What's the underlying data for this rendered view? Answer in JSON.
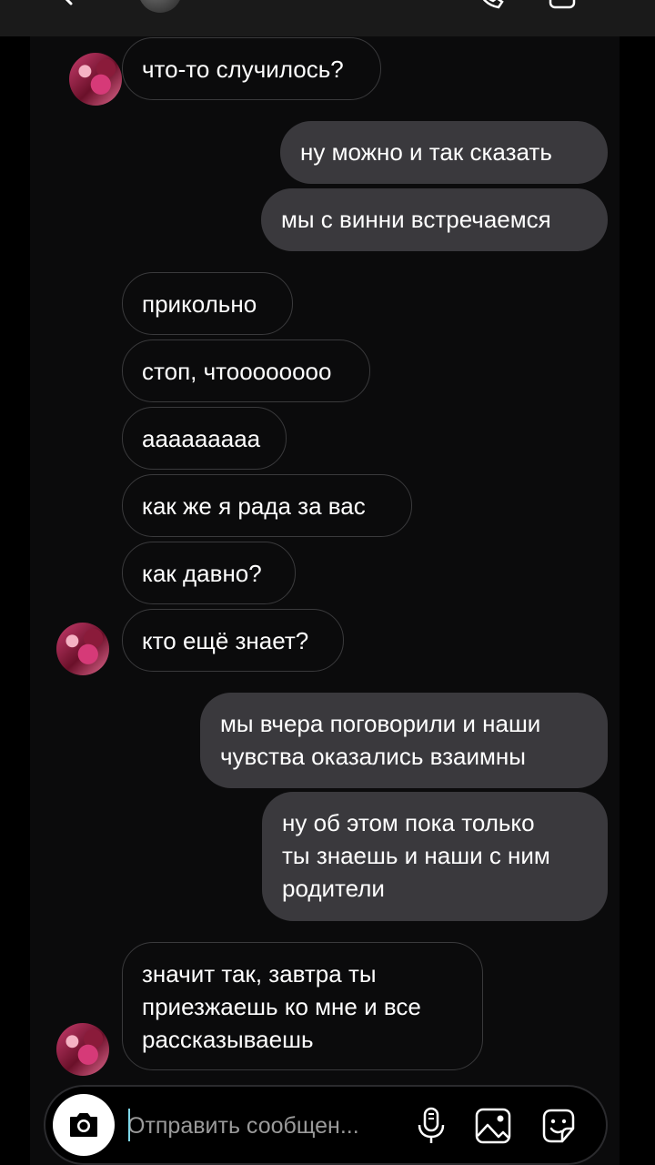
{
  "composer": {
    "placeholder": "Отправить сообщен..."
  },
  "messages": [
    {
      "side": "in",
      "text": "что-то случилось?"
    },
    {
      "side": "out",
      "text": "ну можно и так сказать"
    },
    {
      "side": "out",
      "text": "мы с винни встречаемся"
    },
    {
      "side": "in",
      "text": "прикольно"
    },
    {
      "side": "in",
      "text": "стоп, чтоооооооо"
    },
    {
      "side": "in",
      "text": "ааааааааа"
    },
    {
      "side": "in",
      "text": "как же я рада за вас"
    },
    {
      "side": "in",
      "text": "как давно?"
    },
    {
      "side": "in",
      "text": "кто ещё знает?"
    },
    {
      "side": "out",
      "text": "мы вчера поговорили и наши\nчувства оказались взаимны"
    },
    {
      "side": "out",
      "text": "ну об этом пока только\nты знаешь и наши с ним\nродители"
    },
    {
      "side": "in",
      "text": "значит так, завтра ты\nприезжаешь ко мне и все\nрассказываешь"
    }
  ],
  "icons": {
    "back": "chevron-left-icon",
    "call": "phone-icon",
    "video": "video-camera-icon",
    "camera": "camera-icon",
    "mic": "microphone-icon",
    "gallery": "image-icon",
    "sticker": "sticker-icon"
  },
  "colors": {
    "background": "#000000",
    "incoming_border": "#3a3a3c",
    "outgoing_bubble": "#3a393d",
    "text": "#ffffff",
    "placeholder": "#9a9a9a",
    "caret": "#7fd6e8"
  }
}
